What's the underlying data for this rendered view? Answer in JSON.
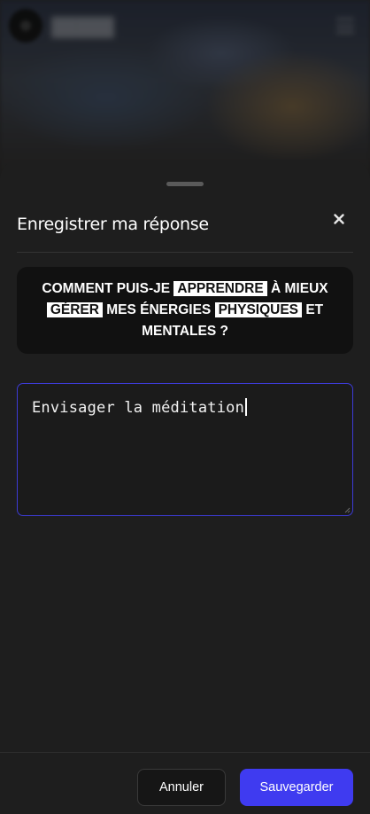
{
  "background_app": {
    "icons": {
      "logo": "app-logo",
      "menu": "hamburger-menu-icon"
    }
  },
  "modal": {
    "title": "Enregistrer ma réponse",
    "close_icon": "close-icon",
    "question": {
      "parts": [
        {
          "text": "COMMENT PUIS-JE ",
          "highlight": false
        },
        {
          "text": "APPRENDRE",
          "highlight": true
        },
        {
          "text": " À MIEUX ",
          "highlight": false
        },
        {
          "text": "GÉRER",
          "highlight": true
        },
        {
          "text": " MES ÉNERGIES ",
          "highlight": false
        },
        {
          "text": "PHYSIQUES",
          "highlight": true
        },
        {
          "text": " ET MENTALES ?",
          "highlight": false
        }
      ]
    },
    "answer": {
      "value": "Envisager la méditation"
    },
    "buttons": {
      "cancel_label": "Annuler",
      "save_label": "Sauvegarder"
    }
  },
  "colors": {
    "accent": "#3f3bf0",
    "focus_border": "#3d3bd6",
    "sheet_bg": "#1e1e1e",
    "card_bg": "#111111"
  }
}
